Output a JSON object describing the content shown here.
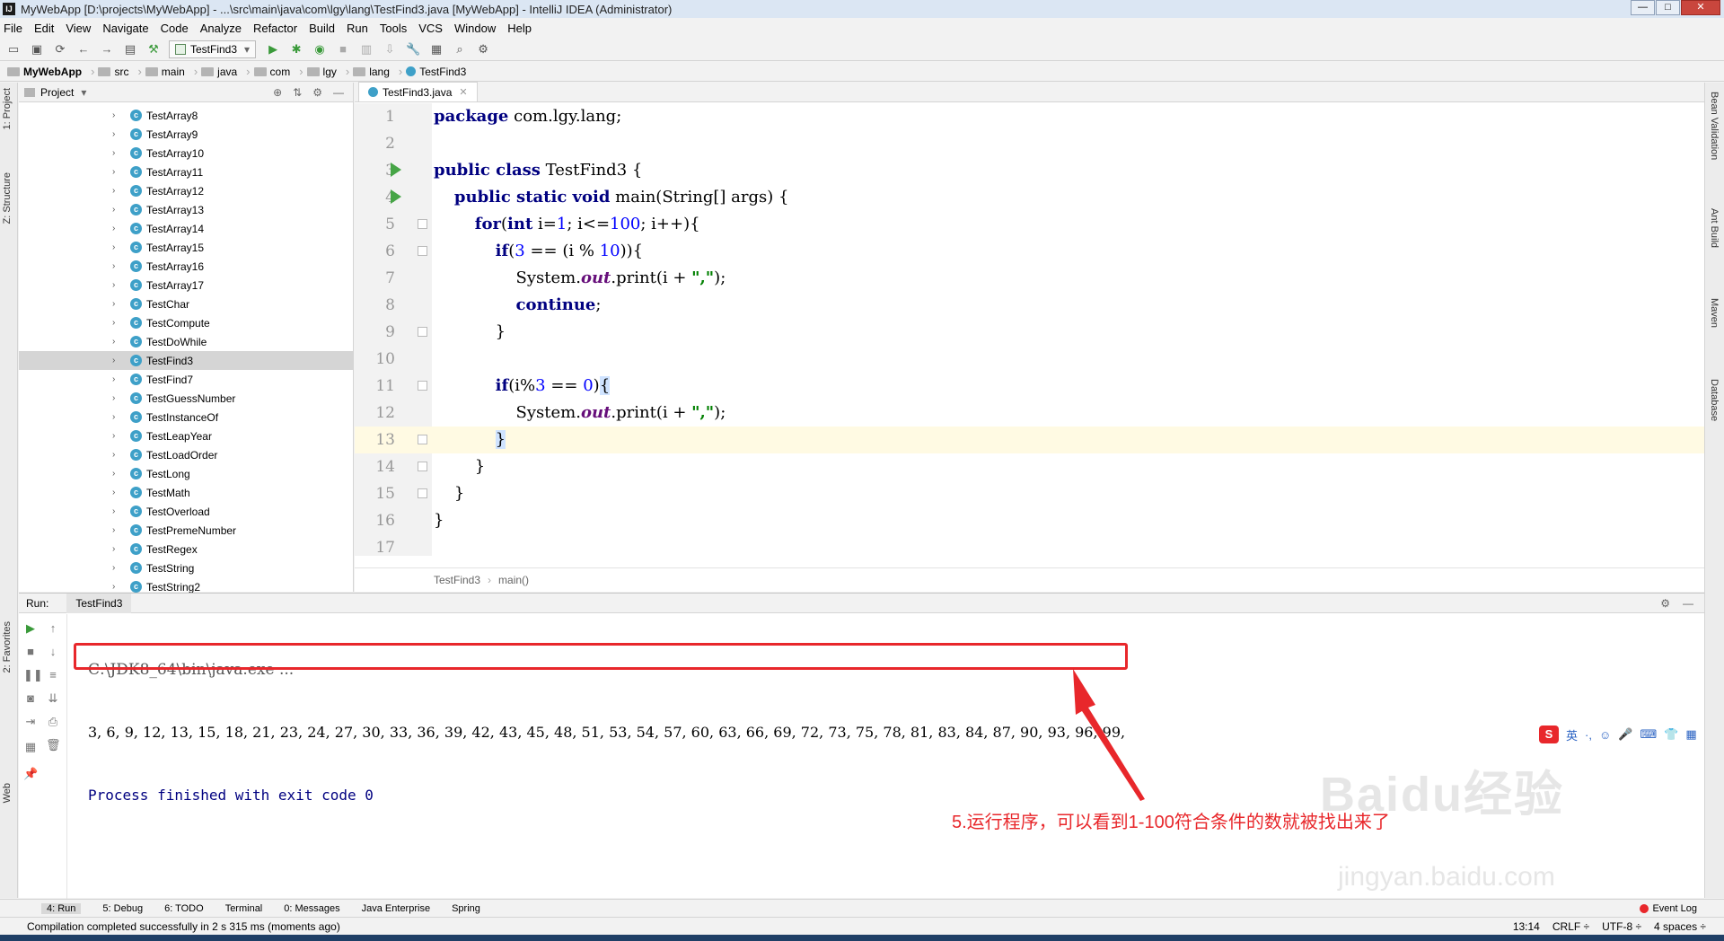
{
  "window": {
    "title": "MyWebApp [D:\\projects\\MyWebApp] - ...\\src\\main\\java\\com\\lgy\\lang\\TestFind3.java [MyWebApp] - IntelliJ IDEA (Administrator)",
    "icon_label": "IJ"
  },
  "menu": [
    "File",
    "Edit",
    "View",
    "Navigate",
    "Code",
    "Analyze",
    "Refactor",
    "Build",
    "Run",
    "Tools",
    "VCS",
    "Window",
    "Help"
  ],
  "toolbar": {
    "run_config": "TestFind3"
  },
  "breadcrumb": {
    "items": [
      "MyWebApp",
      "src",
      "main",
      "java",
      "com",
      "lgy",
      "lang",
      "TestFind3"
    ]
  },
  "side_tabs": {
    "left": [
      "1: Project",
      "Z: Structure",
      "2: Favorites",
      "Web"
    ],
    "right": [
      "Bean Validation",
      "Ant Build",
      "Maven",
      "Database"
    ]
  },
  "project": {
    "header": "Project",
    "items": [
      "TestArray8",
      "TestArray9",
      "TestArray10",
      "TestArray11",
      "TestArray12",
      "TestArray13",
      "TestArray14",
      "TestArray15",
      "TestArray16",
      "TestArray17",
      "TestChar",
      "TestCompute",
      "TestDoWhile",
      "TestFind3",
      "TestFind7",
      "TestGuessNumber",
      "TestInstanceOf",
      "TestLeapYear",
      "TestLoadOrder",
      "TestLong",
      "TestMath",
      "TestOverload",
      "TestPremeNumber",
      "TestRegex",
      "TestString",
      "TestString2"
    ],
    "selected": "TestFind3"
  },
  "editor": {
    "tab": "TestFind3.java",
    "line_numbers": [
      "1",
      "2",
      "3",
      "4",
      "5",
      "6",
      "7",
      "8",
      "9",
      "10",
      "11",
      "12",
      "13",
      "14",
      "15",
      "16",
      "17"
    ],
    "breadcrumb": [
      "TestFind3",
      "main()"
    ]
  },
  "run": {
    "label": "Run:",
    "tab": "TestFind3",
    "lines": [
      "C:\\JDK8_64\\bin\\java.exe ...",
      "3, 6, 9, 12, 13, 15, 18, 21, 23, 24, 27, 30, 33, 36, 39, 42, 43, 45, 48, 51, 53, 54, 57, 60, 63, 66, 69, 72, 73, 75, 78, 81, 83, 84, 87, 90, 93, 96, 99,",
      "Process finished with exit code 0"
    ]
  },
  "annotation": "5.运行程序，可以看到1-100符合条件的数就被找出来了",
  "watermark": {
    "logo": "Baidu经验",
    "url": "jingyan.baidu.com"
  },
  "ime": {
    "label": "英"
  },
  "bottom_tabs": [
    "4: Run",
    "5: Debug",
    "6: TODO",
    "Terminal",
    "0: Messages",
    "Java Enterprise",
    "Spring"
  ],
  "event_log": "Event Log",
  "status": {
    "message": "Compilation completed successfully in 2 s 315 ms (moments ago)",
    "position": "13:14",
    "line_sep": "CRLF ÷",
    "encoding": "UTF-8 ÷",
    "indent": "4 spaces ÷"
  },
  "colors": {
    "accent_red": "#e8272b",
    "keyword": "#000080",
    "string": "#008000",
    "number": "#0000ff",
    "current_line": "#fffae3"
  }
}
